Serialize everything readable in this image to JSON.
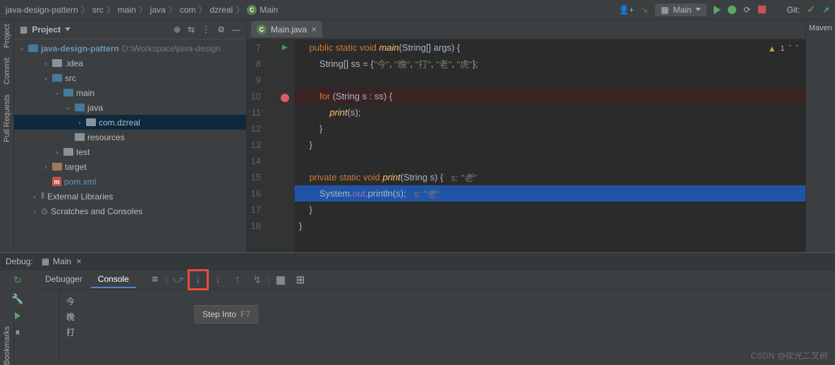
{
  "breadcrumb": [
    "java-design-pattern",
    "src",
    "main",
    "java",
    "com",
    "dzreal",
    "Main"
  ],
  "top": {
    "run_config": "Main",
    "git_label": "Git:"
  },
  "right_panel": {
    "label": "Maven"
  },
  "left_strip": [
    "Project",
    "Commit",
    "Pull Requests",
    "Bookmarks"
  ],
  "project": {
    "title": "Project",
    "root": {
      "name": "java-design-pattern",
      "path": "D:\\Workspace\\java-design"
    },
    "nodes": [
      {
        "indent": 1,
        "chev": "›",
        "icon": "folder",
        "label": ".idea"
      },
      {
        "indent": 1,
        "chev": "⌄",
        "icon": "folder-blue",
        "label": "src"
      },
      {
        "indent": 2,
        "chev": "⌄",
        "icon": "folder-blue",
        "label": "main"
      },
      {
        "indent": 3,
        "chev": "⌄",
        "icon": "folder-blue",
        "label": "java"
      },
      {
        "indent": 4,
        "chev": "›",
        "icon": "folder",
        "label": "com.dzreal",
        "selected": true
      },
      {
        "indent": 3,
        "chev": "",
        "icon": "folder",
        "label": "resources"
      },
      {
        "indent": 2,
        "chev": "›",
        "icon": "folder",
        "label": "test"
      },
      {
        "indent": 1,
        "chev": "›",
        "icon": "folder-orange",
        "label": "target"
      },
      {
        "indent": 1,
        "chev": "",
        "icon": "m",
        "label": "pom.xml",
        "blue": true
      },
      {
        "indent": 0,
        "chev": "›",
        "icon": "lib",
        "label": "External Libraries"
      },
      {
        "indent": 0,
        "chev": "›",
        "icon": "scratch",
        "label": "Scratches and Consoles"
      }
    ]
  },
  "editor": {
    "tab": "Main.java",
    "warn_count": "1",
    "lines": [
      {
        "n": 7,
        "gut": "play"
      },
      {
        "n": 8
      },
      {
        "n": 9
      },
      {
        "n": 10,
        "gut": "bp",
        "bp": true
      },
      {
        "n": 11
      },
      {
        "n": 12
      },
      {
        "n": 13
      },
      {
        "n": 14
      },
      {
        "n": 15
      },
      {
        "n": 16,
        "exec": true
      },
      {
        "n": 17
      },
      {
        "n": 18
      }
    ],
    "code": {
      "l7": {
        "kw1": "public static void",
        "fn": "main",
        "rest": "(String[] args) {"
      },
      "l8": {
        "pre": "        String[] ss = {",
        "s1": "\"今\"",
        "c1": ", ",
        "s2": "\"晚\"",
        "c2": ", ",
        "s3": "\"打\"",
        "c3": ", ",
        "s4": "\"老\"",
        "c4": ", ",
        "s5": "\"虎\"",
        "post": "};"
      },
      "l10": {
        "kw": "for",
        "rest": " (String s : ss) {"
      },
      "l11": {
        "fn": "print",
        "rest": "(s);"
      },
      "l12": {
        "txt": "        }"
      },
      "l13": {
        "txt": "    }"
      },
      "l15": {
        "kw": "private static void",
        "fn": "print",
        "rest": "(String s) {   ",
        "hint": "s: \"老\""
      },
      "l16": {
        "pre": "        System.",
        "fld": "out",
        "mid": ".println(s);   ",
        "hint": "s: \"老\""
      },
      "l17": {
        "txt": "    }"
      },
      "l18": {
        "txt": "}"
      }
    }
  },
  "debug": {
    "title": "Debug:",
    "tab": "Main",
    "subtabs": {
      "debugger": "Debugger",
      "console": "Console"
    },
    "tooltip": {
      "label": "Step Into",
      "key": "F7"
    },
    "output": [
      "今",
      "晚",
      "打"
    ]
  },
  "watermark": "CSDN @砍光二叉树"
}
